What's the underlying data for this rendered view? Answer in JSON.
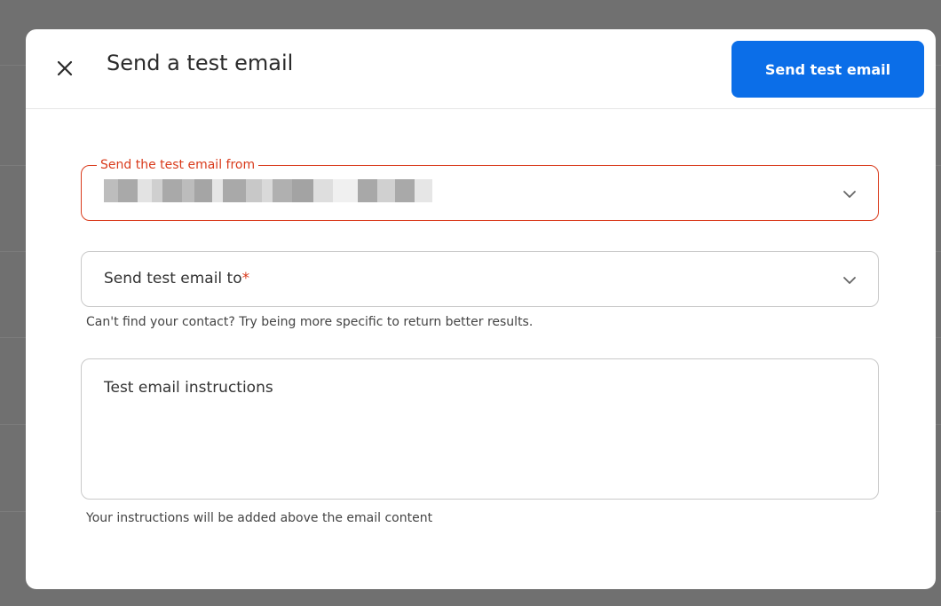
{
  "dialog": {
    "title": "Send a test email",
    "primary_button": "Send test email"
  },
  "from_field": {
    "label": "Send the test email from",
    "value_redacted": true
  },
  "to_field": {
    "placeholder": "Send test email to",
    "required_marker": "*",
    "helper": "Can't find your contact? Try being more specific to return better results."
  },
  "instructions_field": {
    "placeholder": "Test email instructions",
    "helper": "Your instructions will be added above the email content"
  },
  "icons": {
    "close": "close-icon",
    "chevron": "chevron-down-icon"
  },
  "colors": {
    "accent": "#0b6ee8",
    "error": "#d93b1c",
    "overlay": "#707070"
  }
}
